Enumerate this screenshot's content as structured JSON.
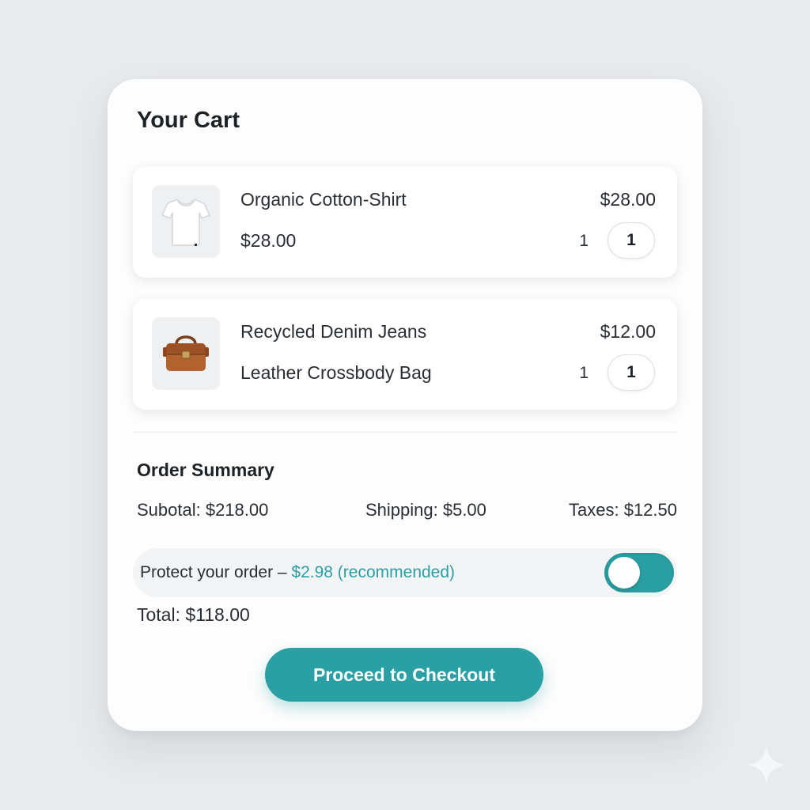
{
  "cart": {
    "title": "Your Cart",
    "items": [
      {
        "line1": "Organic Cotton-Shirt",
        "line2": "$28.00",
        "price": "$28.00",
        "qty_label": "1",
        "qty_value": "1",
        "thumb_icon": "tshirt-icon"
      },
      {
        "line1": "Recycled Denim Jeans",
        "line2": "Leather Crossbody Bag",
        "price": "$12.00",
        "qty_label": "1",
        "qty_value": "1",
        "thumb_icon": "leather-bag-icon"
      }
    ]
  },
  "summary": {
    "title": "Order Summary",
    "subtotal": "Subotal: $218.00",
    "shipping": "Shipping: $5.00",
    "taxes": "Taxes: $12.50"
  },
  "protect": {
    "label": "Protect your order – ",
    "price_note": "$2.98 (recommended)",
    "toggle_on": true
  },
  "total": "Total: $118.00",
  "checkout_label": "Proceed to Checkout",
  "colors": {
    "accent": "#2aa0a4",
    "background": "#e8ebee",
    "card": "#fdfdfd"
  },
  "corner_icon": "sparkle-icon"
}
